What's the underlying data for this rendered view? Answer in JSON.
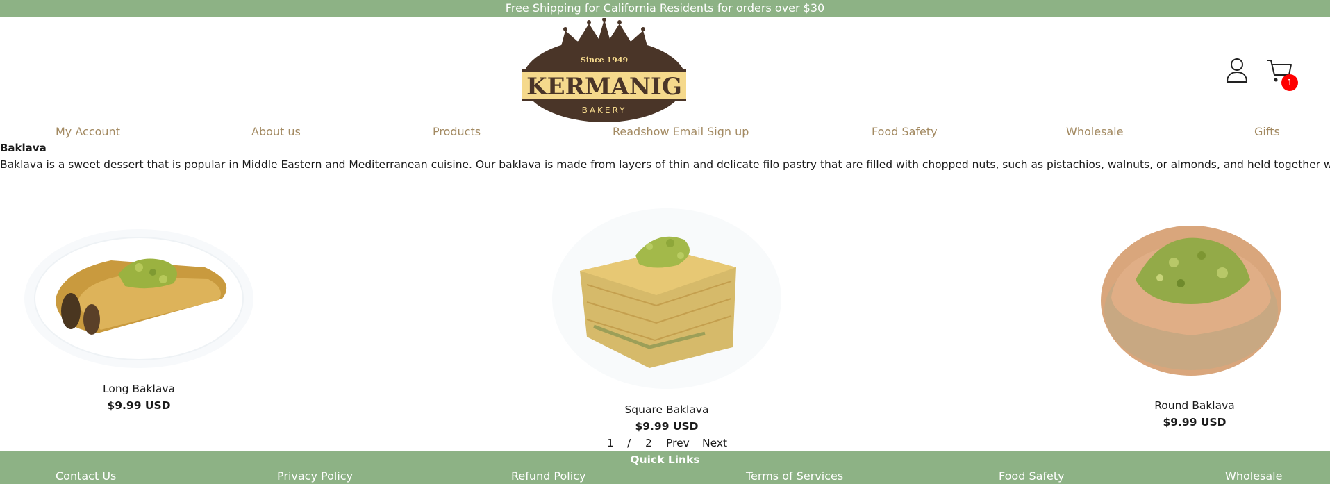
{
  "announcement": "Free Shipping for California Residents for orders over $30",
  "logo": {
    "since": "Since 1949",
    "brand": "KERMANIG",
    "sub": "BAKERY"
  },
  "header": {
    "account_icon": "user-icon",
    "cart_icon": "cart-icon",
    "cart_count": "1"
  },
  "nav": [
    "My Account",
    "About us",
    "Products",
    "Readshow Email Sign up",
    "Food Safety",
    "Wholesale",
    "Gifts"
  ],
  "section": {
    "title": "Baklava",
    "description": "Baklava is a sweet dessert that is popular in Middle Eastern and Mediterranean cuisine. Our baklava is made from layers of thin and delicate filo pastry that are filled with chopped nuts, such as pistachios, walnuts, or almonds, and held together with syrup."
  },
  "products": [
    {
      "name": "Long Baklava",
      "price": "$9.99 USD"
    },
    {
      "name": "Square Baklava",
      "price": "$9.99 USD"
    },
    {
      "name": "Round Baklava",
      "price": "$9.99 USD"
    }
  ],
  "pagination": {
    "current": "1",
    "separator": "/",
    "total": "2",
    "prev": "Prev",
    "next": "Next"
  },
  "footer": {
    "title": "Quick Links",
    "links": [
      "Contact Us",
      "Privacy Policy",
      "Refund Policy",
      "Terms of Services",
      "Food Safety",
      "Wholesale"
    ]
  },
  "colors": {
    "brand_green": "#8db285",
    "nav_gold": "#a38a62",
    "logo_brown": "#4a3528",
    "logo_cream": "#f5d98c",
    "badge_red": "#ff0000"
  }
}
